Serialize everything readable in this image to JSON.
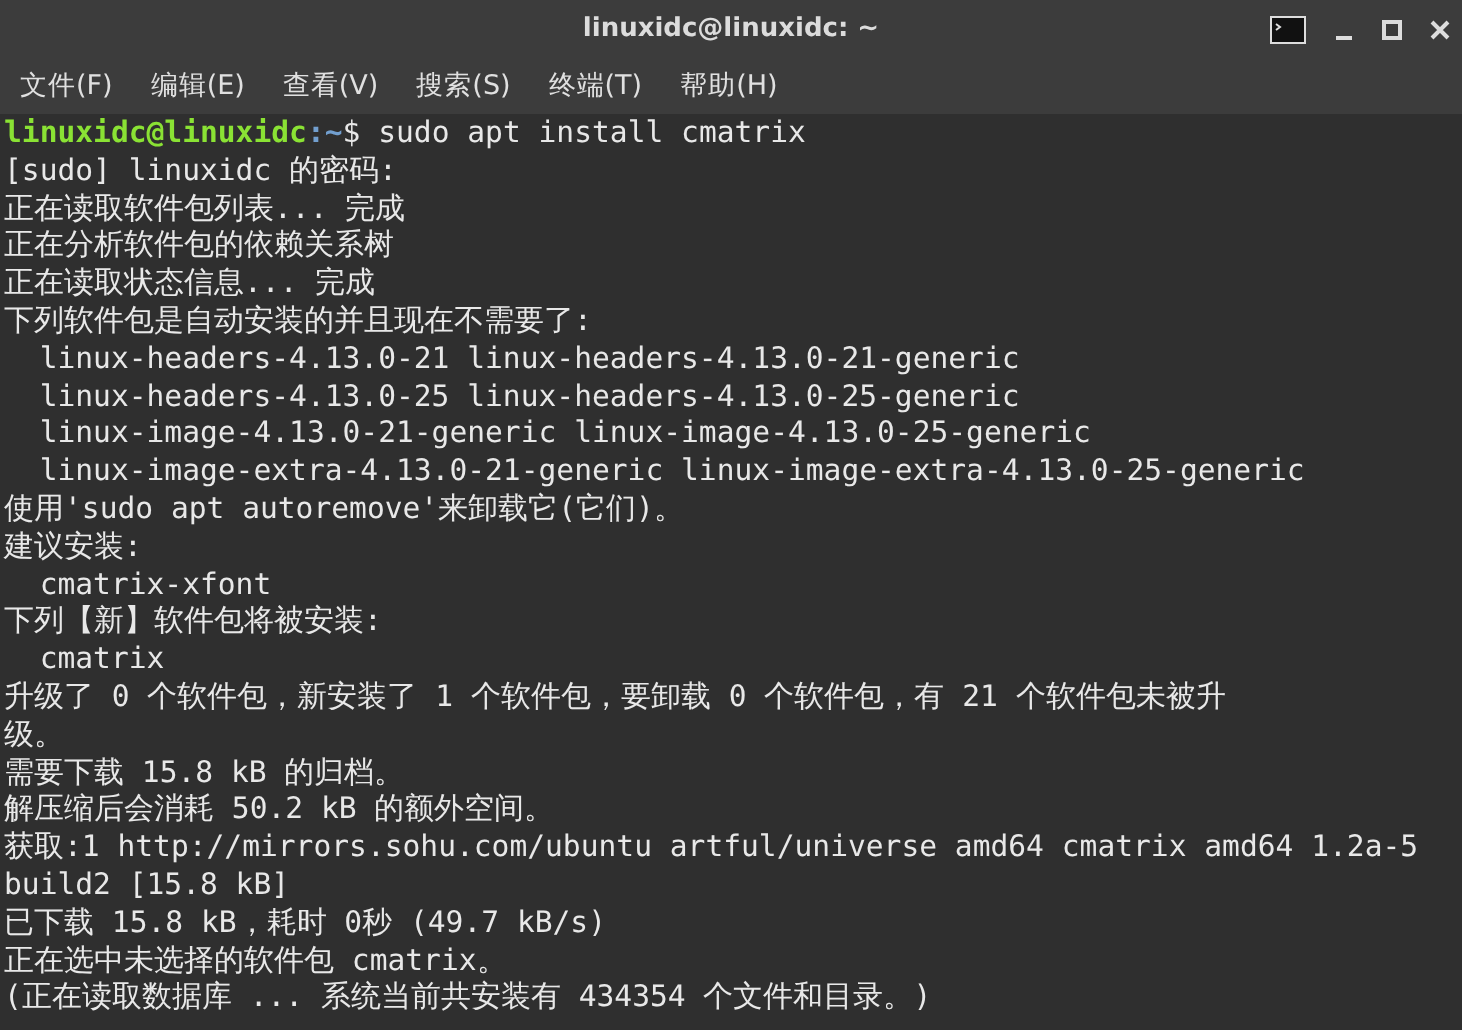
{
  "window": {
    "title": "linuxidc@linuxidc: ~"
  },
  "menu": [
    "文件(F)",
    "编辑(E)",
    "查看(V)",
    "搜索(S)",
    "终端(T)",
    "帮助(H)"
  ],
  "terminal": {
    "lines": [
      {
        "kind": "prompt",
        "user_host": "linuxidc@linuxidc",
        "path": ":~",
        "command": "$ sudo apt install cmatrix"
      },
      {
        "kind": "output",
        "text": "[sudo] linuxidc 的密码:"
      },
      {
        "kind": "output",
        "text": "正在读取软件包列表... 完成"
      },
      {
        "kind": "output",
        "text": "正在分析软件包的依赖关系树"
      },
      {
        "kind": "output",
        "text": "正在读取状态信息... 完成"
      },
      {
        "kind": "output",
        "text": "下列软件包是自动安装的并且现在不需要了:"
      },
      {
        "kind": "output",
        "text": "  linux-headers-4.13.0-21 linux-headers-4.13.0-21-generic"
      },
      {
        "kind": "output",
        "text": "  linux-headers-4.13.0-25 linux-headers-4.13.0-25-generic"
      },
      {
        "kind": "output",
        "text": "  linux-image-4.13.0-21-generic linux-image-4.13.0-25-generic"
      },
      {
        "kind": "output",
        "text": "  linux-image-extra-4.13.0-21-generic linux-image-extra-4.13.0-25-generic"
      },
      {
        "kind": "output",
        "text": "使用'sudo apt autoremove'来卸载它(它们)。"
      },
      {
        "kind": "output",
        "text": "建议安装:"
      },
      {
        "kind": "output",
        "text": "  cmatrix-xfont"
      },
      {
        "kind": "output",
        "text": "下列【新】软件包将被安装:"
      },
      {
        "kind": "output",
        "text": "  cmatrix"
      },
      {
        "kind": "output",
        "text": "升级了 0 个软件包，新安装了 1 个软件包，要卸载 0 个软件包，有 21 个软件包未被升"
      },
      {
        "kind": "output",
        "text": "级。"
      },
      {
        "kind": "output",
        "text": "需要下载 15.8 kB 的归档。"
      },
      {
        "kind": "output",
        "text": "解压缩后会消耗 50.2 kB 的额外空间。"
      },
      {
        "kind": "output",
        "text": "获取:1 http://mirrors.sohu.com/ubuntu artful/universe amd64 cmatrix amd64 1.2a-5"
      },
      {
        "kind": "output",
        "text": "build2 [15.8 kB]"
      },
      {
        "kind": "output",
        "text": "已下载 15.8 kB，耗时 0秒 (49.7 kB/s)"
      },
      {
        "kind": "output",
        "text": "正在选中未选择的软件包 cmatrix。"
      },
      {
        "kind": "output",
        "text": "(正在读取数据库 ... 系统当前共安装有 434354 个文件和目录。)"
      }
    ]
  }
}
